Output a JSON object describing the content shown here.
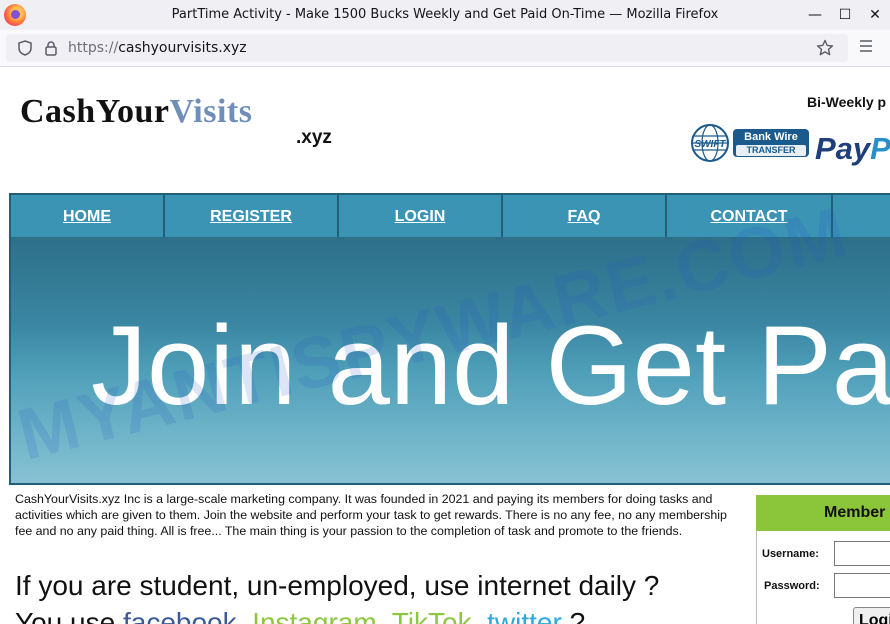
{
  "browser": {
    "window_title": "PartTime Activity - Make 1500 Bucks Weekly and Get Paid On-Time — Mozilla Firefox",
    "minimize": "—",
    "maximize": "☐",
    "close": "✕",
    "url_scheme": "https://",
    "url_host": "cashyourvisits.xyz"
  },
  "header": {
    "logo_cash": "CashYour",
    "logo_visits": "Visits",
    "logo_tld": ".xyz",
    "biweekly_text": "Bi-Weekly p",
    "bankwire_line1": "Bank Wire",
    "bankwire_line2": "TRANSFER",
    "swift_text": "SWIFT",
    "paypal_pay": "Pay",
    "paypal_pal": "P"
  },
  "nav": {
    "items": [
      {
        "label": "HOME"
      },
      {
        "label": "REGISTER"
      },
      {
        "label": "LOGIN"
      },
      {
        "label": "FAQ"
      },
      {
        "label": "CONTACT"
      }
    ]
  },
  "banner": {
    "headline": "Join and Get Paid"
  },
  "watermark": "MYANTISPYWARE.COM",
  "content": {
    "intro": "CashYourVisits.xyz Inc is a large-scale marketing company. It was founded in 2021 and paying its members for doing tasks and activities which are given to them. Join the website and perform your task to get rewards. There is no any fee, no any membership fee and no any paid thing. All is free... The main thing is your passion to the completion of task and promote to the friends.",
    "question1": "If you are student, un-employed, use internet daily ?",
    "q2_prefix": "You use",
    "q2_facebook": "facebook",
    "q2_sep1": ",",
    "q2_instagram": "Instagram",
    "q2_sep2": ",",
    "q2_tiktok": "TikTok",
    "q2_sep3": ",",
    "q2_twitter": "twitter",
    "q2_suffix": "?"
  },
  "member": {
    "header": "Member",
    "username_label": "Username:",
    "password_label": "Password:",
    "login_button": "Login"
  }
}
